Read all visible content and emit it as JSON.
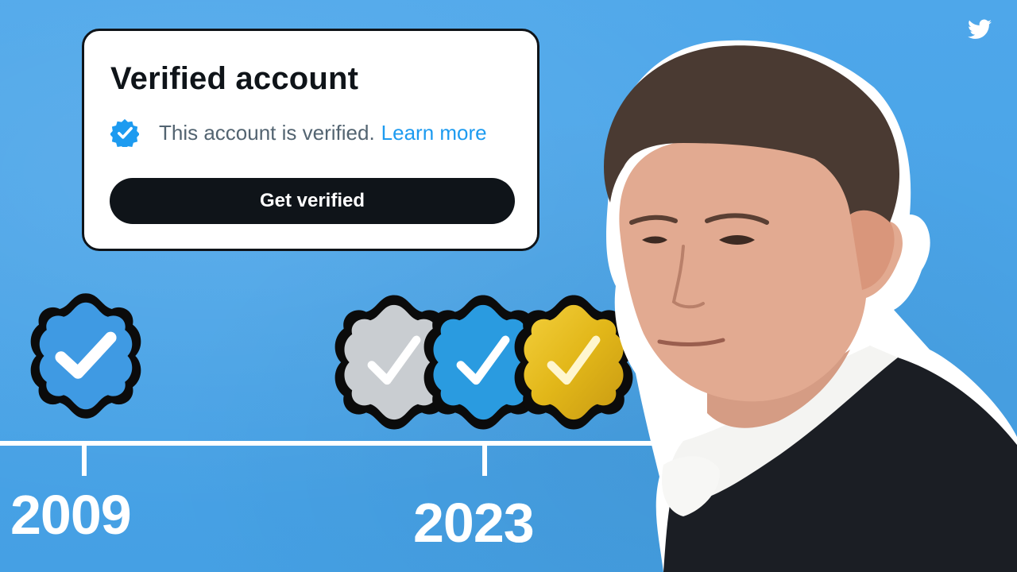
{
  "card": {
    "title": "Verified account",
    "status_text": "This account is verified.",
    "learn_more": "Learn more",
    "cta_label": "Get verified"
  },
  "timeline": {
    "start_year": "2009",
    "end_year": "2023"
  },
  "badges": {
    "legacy": {
      "icon": "verified-badge-icon",
      "color": "#1d9bf0"
    },
    "gray": {
      "icon": "gray-check-badge-icon",
      "color": "#c9cdd1"
    },
    "blue": {
      "icon": "blue-check-badge-icon",
      "color": "#1d9bf0"
    },
    "gold": {
      "icon": "gold-check-badge-icon",
      "color": "#e2b719"
    }
  },
  "icons": {
    "brand": "twitter-bird-icon"
  },
  "colors": {
    "background": "#4aa3e6",
    "accent": "#1d9bf0",
    "dark": "#0f1419"
  }
}
